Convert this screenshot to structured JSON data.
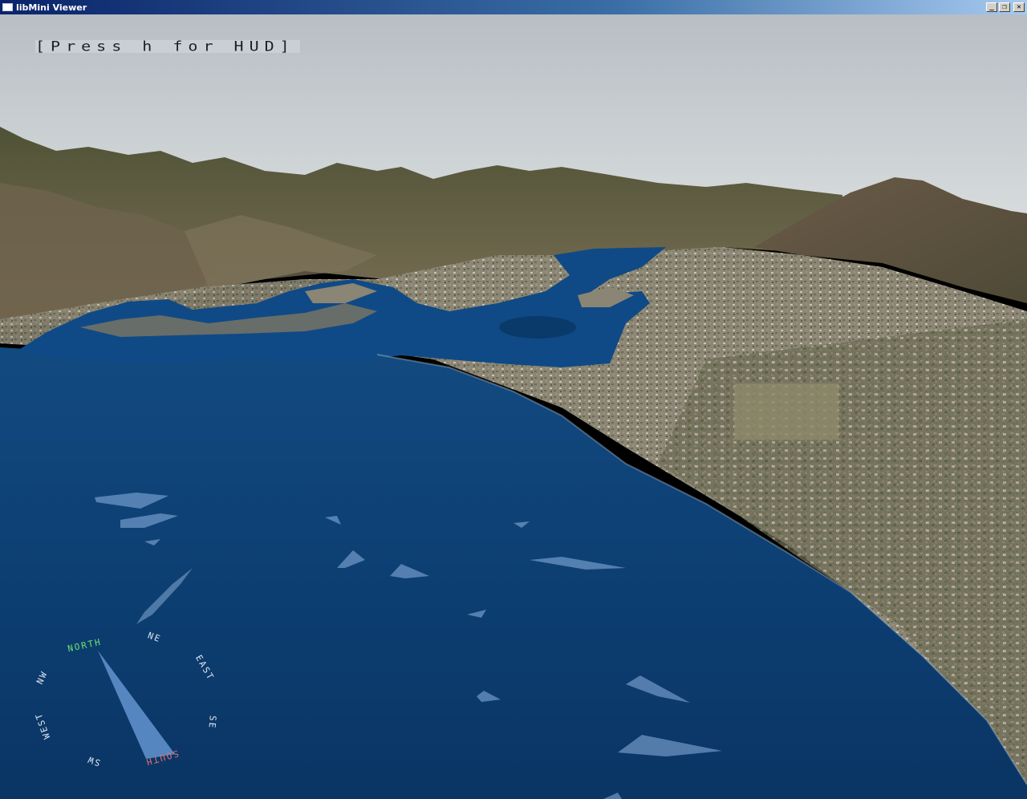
{
  "window": {
    "title": "libMini Viewer",
    "buttons": {
      "minimize": "_",
      "restore": "❐",
      "close": "✕"
    }
  },
  "hud": {
    "hint": "[Press h for HUD]"
  },
  "compass": {
    "north": "NORTH",
    "ne": "NE",
    "east": "EAST",
    "se": "SE",
    "south": "SOUTH",
    "sw": "SW",
    "west": "WEST",
    "nw": "NW",
    "colors": {
      "north": "#6ee56e",
      "south": "#e07070",
      "other": "#dfe6ee",
      "needle": "#5b8ac4"
    }
  },
  "scene": {
    "sky_top": "#b9c0c6",
    "sky_horizon": "#d6dbde",
    "ocean": "#0d3f73",
    "ocean_deep": "#0a3462",
    "mountains": "#5a5a3c",
    "urban": "#8a8576"
  }
}
